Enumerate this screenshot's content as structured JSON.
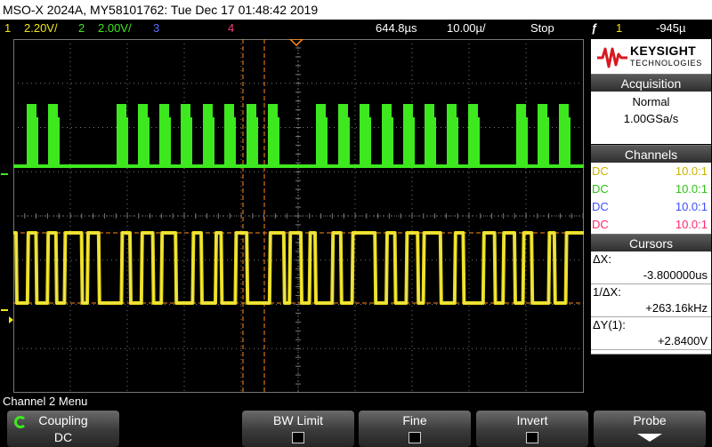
{
  "title_bar": {
    "text": "MSO-X 2024A, MY58101762: Tue Dec 17 01:48:42 2019"
  },
  "status_bar": {
    "ch1_num": "1",
    "ch1_scale": "2.20V/",
    "ch2_num": "2",
    "ch2_scale": "2.00V/",
    "ch3_num": "3",
    "ch4_num": "4",
    "time_delay": "644.8µs",
    "time_scale": "10.00µ/",
    "run_state": "Stop",
    "trigger_icon": "ƒ",
    "trigger_source": "1",
    "trigger_level": "-945µ"
  },
  "waveform": {
    "ch2_label": "2",
    "ch1_label": "1",
    "ch1_color": "#f2e51c",
    "ch2_color": "#3ee81f",
    "grid_color": "#777777",
    "cursor_color": "#ff8c1a",
    "pattern": [
      4,
      3,
      4,
      3,
      3,
      6,
      2,
      4,
      8,
      3,
      4,
      4,
      3,
      5,
      6,
      3,
      5,
      2,
      5,
      4,
      8,
      5,
      2,
      4,
      3,
      2,
      6,
      3,
      4,
      8,
      4,
      3,
      4,
      4,
      2,
      6,
      5,
      3,
      7
    ],
    "bursts": [
      30,
      54,
      131,
      155,
      179,
      203,
      228,
      252,
      277,
      301,
      355,
      380,
      404,
      429,
      453,
      477,
      502,
      526,
      580,
      604,
      628
    ]
  },
  "brand": {
    "line1": "KEYSIGHT",
    "line2": "TECHNOLOGIES"
  },
  "acquisition": {
    "header": "Acquisition",
    "mode": "Normal",
    "rate": "1.00GSa/s"
  },
  "channels": {
    "header": "Channels",
    "rows": [
      {
        "coupling": "DC",
        "probe": "10.0:1",
        "color": "#e0c800"
      },
      {
        "coupling": "DC",
        "probe": "10.0:1",
        "color": "#36d61a"
      },
      {
        "coupling": "DC",
        "probe": "10.0:1",
        "color": "#3a4dff"
      },
      {
        "coupling": "DC",
        "probe": "10.0:1",
        "color": "#ff2a6a"
      }
    ]
  },
  "cursors": {
    "header": "Cursors",
    "dx_label": "ΔX:",
    "dx_value": "-3.800000us",
    "inv_label": "1/ΔX:",
    "inv_value": "+263.16kHz",
    "dy_label": "ΔY(1):",
    "dy_value": "+2.8400V"
  },
  "menu": {
    "title": "Channel 2 Menu"
  },
  "softkeys": {
    "coupling_label": "Coupling",
    "coupling_value": "DC",
    "bw_limit_label": "BW Limit",
    "fine_label": "Fine",
    "invert_label": "Invert",
    "probe_label": "Probe"
  },
  "icons": {
    "coupling": "rotate-arrow-icon",
    "probe": "down-arrow-icon",
    "trigger": "trigger-edge-icon",
    "brand": "keysight-wave-icon"
  }
}
